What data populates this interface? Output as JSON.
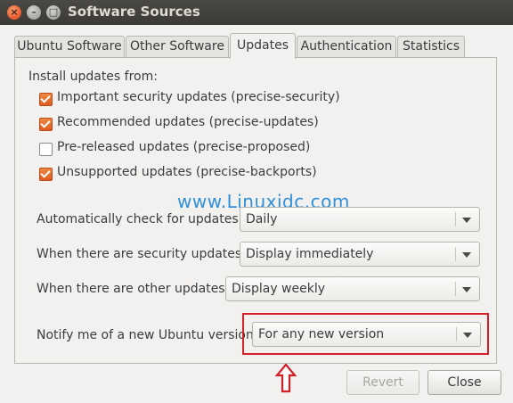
{
  "window": {
    "title": "Software Sources",
    "close_glyph": "×",
    "min_glyph": "–",
    "max_glyph": "□"
  },
  "tabs": [
    {
      "label": "Ubuntu Software",
      "active": false
    },
    {
      "label": "Other Software",
      "active": false
    },
    {
      "label": "Updates",
      "active": true
    },
    {
      "label": "Authentication",
      "active": false
    },
    {
      "label": "Statistics",
      "active": false
    }
  ],
  "updates": {
    "install_from_label": "Install updates from:",
    "sources": [
      {
        "label": "Important security updates (precise-security)",
        "checked": true
      },
      {
        "label": "Recommended updates (precise-updates)",
        "checked": true
      },
      {
        "label": "Pre-released updates (precise-proposed)",
        "checked": false
      },
      {
        "label": "Unsupported updates (precise-backports)",
        "checked": true
      }
    ],
    "auto_check": {
      "label": "Automatically check for updates:",
      "value": "Daily"
    },
    "security_updates": {
      "label": "When there are security updates:",
      "value": "Display immediately"
    },
    "other_updates": {
      "label": "When there are other updates:",
      "value": "Display weekly"
    },
    "notify_version": {
      "label": "Notify me of a new Ubuntu version",
      "value": "For any new version"
    }
  },
  "watermark": "www.Linuxidc.com",
  "buttons": {
    "revert": "Revert",
    "close": "Close"
  },
  "colors": {
    "accent_orange": "#de5b20",
    "highlight_red": "#d12027",
    "watermark_blue": "#2f8fd8"
  }
}
